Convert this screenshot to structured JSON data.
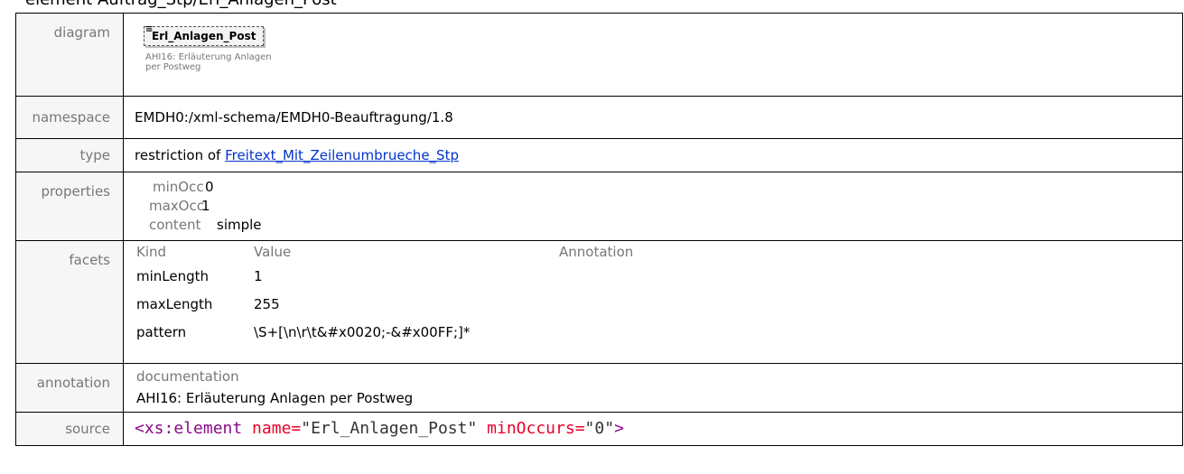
{
  "heading": "element Auftrag_Stp/Erl_Anlagen_Post",
  "diagram": {
    "label": "diagram",
    "element_name": "Erl_Anlagen_Post",
    "marker": "≡",
    "annotation": "AHI16: Erläuterung Anlagen per Postweg"
  },
  "namespace": {
    "label": "namespace",
    "value": "EMDH0:/xml-schema/EMDH0-Beauftragung/1.8"
  },
  "type": {
    "label": "type",
    "prefix": "restriction of ",
    "link": "Freitext_Mit_Zeilenumbrueche_Stp"
  },
  "properties": {
    "label": "properties",
    "items": [
      {
        "key": "minOcc",
        "value": "0"
      },
      {
        "key": "maxOcc",
        "value": "1"
      },
      {
        "key": "content",
        "value": "simple"
      }
    ]
  },
  "facets": {
    "label": "facets",
    "headers": [
      "Kind",
      "Value",
      "Annotation"
    ],
    "rows": [
      {
        "kind": "minLength",
        "value": "1",
        "annotation": ""
      },
      {
        "kind": "maxLength",
        "value": "255",
        "annotation": ""
      },
      {
        "kind": "pattern",
        "value": "\\S+[\\n\\r\\t&#x0020;-&#x00FF;]*",
        "annotation": ""
      }
    ]
  },
  "annotation": {
    "label": "annotation",
    "head": "documentation",
    "text": "AHI16: Erläuterung Anlagen per Postweg"
  },
  "source": {
    "label": "source",
    "open": "<xs:element",
    "attr1": " name=",
    "val1": "\"Erl_Anlagen_Post\"",
    "attr2": " minOccurs=",
    "val2": "\"0\"",
    "close": ">"
  }
}
